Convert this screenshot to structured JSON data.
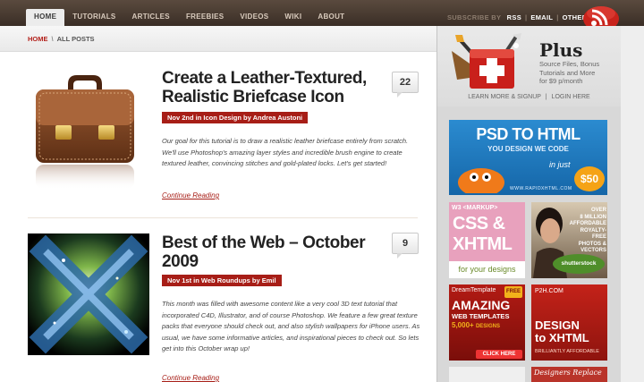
{
  "nav": {
    "items": [
      "HOME",
      "TUTORIALS",
      "ARTICLES",
      "FREEBIES",
      "VIDEOS",
      "WIKI",
      "ABOUT"
    ],
    "active": 0
  },
  "subscribe": {
    "label": "SUBSCRIBE BY",
    "rss": "RSS",
    "email": "EMAIL",
    "other": "OTHER"
  },
  "breadcrumb": {
    "home": "HOME",
    "separator": "\\",
    "current": "ALL POSTS"
  },
  "posts": [
    {
      "title_line1": "Create a Leather-Textured,",
      "title_line2": "Realistic Briefcase Icon",
      "meta": "Nov 2nd in Icon Design by Andrea Austoni",
      "comments": "22",
      "excerpt": "Our goal for this tutorial is to draw a realistic leather briefcase entirely from scratch. We'll use Photoshop's amazing layer styles and incredible brush engine to create textured leather, convincing stitches and gold-plated locks. Let's get started!",
      "more": "Continue Reading"
    },
    {
      "title_line1": "Best of the Web – October",
      "title_line2": "2009",
      "meta": "Nov 1st in Web Roundups by Emil",
      "comments": "9",
      "excerpt": "This month was filled with awesome content like a very cool 3D text tutorial that incorporated C4D, Illustrator, and of course Photoshop. We feature a few great texture packs that everyone should check out, and also stylish wallpapers for iPhone users. As usual, we have some informative articles, and inspirational pieces to check out. So lets get into this October wrap up!",
      "more": "Continue Reading"
    }
  ],
  "plus": {
    "title": "Plus",
    "desc_line1": "Source Files, Bonus",
    "desc_line2": "Tutorials and More",
    "desc_line3": "for $9 p/month",
    "learn": "LEARN MORE & SIGNUP",
    "sep": "|",
    "login": "LOGIN HERE"
  },
  "ads": {
    "psd": {
      "line1": "PSD TO HTML",
      "line2": "YOU DESIGN WE CODE",
      "line3": "in just",
      "price": "$50",
      "url": "WWW.RAPIDXHTML.COM"
    },
    "w3": {
      "tag": "W3 <MARKUP>",
      "line1": "CSS &",
      "line2": "XHTML",
      "line3": "for your designs"
    },
    "shutter": {
      "line1": "OVER",
      "line2": "8 MILLION",
      "line3": "AFFORDABLE",
      "line4": "ROYALTY-FREE",
      "line5": "PHOTOS &",
      "line6": "VECTORS",
      "brand": "shutterstock"
    },
    "dream": {
      "brand": "DreamTemplate",
      "badge": "FREE",
      "line1": "AMAZING",
      "line2": "WEB TEMPLATES",
      "line3": "5,000+",
      "line4": "DESIGNS",
      "cta": "CLICK HERE"
    },
    "p2h": {
      "brand": "P2H.COM",
      "line1": "DESIGN",
      "line2": "to XHTML",
      "line3": "BRILLIANTLY AFFORDABLE"
    },
    "designers": {
      "text": "Designers Replace"
    }
  },
  "colors": {
    "accent": "#a71e17",
    "topbar": "#4a3c32",
    "sidebar": "#d8d8d8"
  }
}
